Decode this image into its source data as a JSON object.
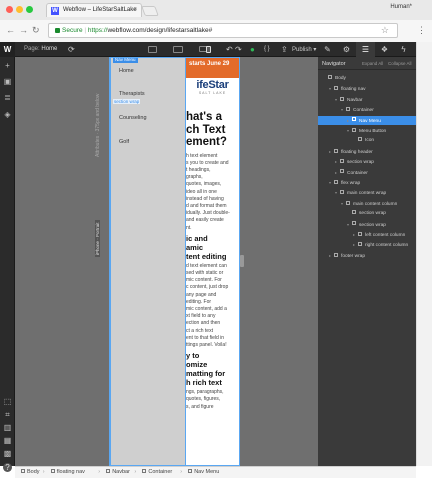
{
  "browser": {
    "tab_title": "Webflow – LifeStarSaltLake",
    "tab_favicon": "W",
    "tab_close": "×",
    "user": "Human*",
    "secure_label": "Secure",
    "url_sep": " | ",
    "url_scheme": "https://",
    "url": "webflow.com/design/lifestarsaltlake#",
    "back_icon": "←",
    "forward_icon": "→",
    "reload_icon": "↻",
    "star_icon": "☆",
    "menu_icon": "⋮",
    "dot_colors": [
      "#ff5f57",
      "#ffbd2e",
      "#28c940"
    ]
  },
  "designer": {
    "logo": "W",
    "page_label": "Page:",
    "page_name": "Home",
    "settings_icon": "⟳",
    "undo_icon": "↶",
    "redo_icon": "↷",
    "check_icon": "●",
    "code_icon": "{ }",
    "export_icon": "⇪",
    "publish_label": "Publish ▾",
    "right_tabs": [
      {
        "icon": "brush-icon",
        "glyph": "✎"
      },
      {
        "icon": "gear-icon",
        "glyph": "⚙"
      },
      {
        "icon": "navigator-icon",
        "glyph": "☰"
      },
      {
        "icon": "drops-icon",
        "glyph": "❖"
      },
      {
        "icon": "interactions-icon",
        "glyph": "ϟ"
      }
    ],
    "left_rail": [
      "+",
      "▣",
      "≣",
      "◈",
      "▤"
    ],
    "left_rail_bottom": [
      "⬚",
      "⌗",
      "▥",
      "▦",
      "▩",
      "?"
    ]
  },
  "canvas": {
    "nav_menu_tag": "Nav Menu",
    "nav_links": [
      "Home",
      "Therapists",
      "Counseling",
      "Golf"
    ],
    "section_wrap_tag": "section wrap",
    "hero_text": "starts June 29",
    "brand_big": "ifeStar",
    "brand_small": "SALT LAKE",
    "article_h1": "hat's a\nch Text\nement?",
    "article_p1": "h text element\ns you to create and\nt headings,\ngraphs,\nquotes, images,\nideo all in one\ninstead of having\nd and format them\nidually. Just double-\nand easily create\nnt.",
    "article_h2": "ic and\namic\ntent editing",
    "article_p2": "d text element can\nsed with static or\nmic content. For\nc content, just drop\nany page and\nediting. For\nmic content, add a\nxt field to any\nection and then\nct a rich text\nent to that field in\nttings panel. Voila!",
    "article_h3": "y to\nomize\nmatting for\nh rich text",
    "article_p3": "ngs, paragraphs,\nquotes, figures,\ns, and figure",
    "side_label_1": "Attributes · 375px and below",
    "side_label_2": "iPhone · Portrait"
  },
  "navigator": {
    "title": "Navigator",
    "expand_all": "Expand All",
    "collapse_all": "Collapse All",
    "rows": [
      {
        "label": "Body",
        "depth": 0,
        "caret": "",
        "selected": false
      },
      {
        "label": "floating nav",
        "depth": 1,
        "caret": "▾",
        "selected": false
      },
      {
        "label": "Navbar",
        "depth": 2,
        "caret": "▾",
        "selected": false
      },
      {
        "label": "Container",
        "depth": 3,
        "caret": "▾",
        "selected": false
      },
      {
        "label": "Nav Menu",
        "depth": 4,
        "caret": "▸",
        "selected": true
      },
      {
        "label": "Menu Button",
        "depth": 4,
        "caret": "▾",
        "selected": false
      },
      {
        "label": "Icon",
        "depth": 5,
        "caret": "",
        "selected": false
      },
      {
        "label": "floating header",
        "depth": 1,
        "caret": "▸",
        "selected": false
      },
      {
        "label": "section wrap",
        "depth": 2,
        "caret": "▸",
        "selected": false
      },
      {
        "label": "Container",
        "depth": 2,
        "caret": "▸",
        "selected": false
      },
      {
        "label": "flex wrap",
        "depth": 1,
        "caret": "▾",
        "selected": false
      },
      {
        "label": "main content wrap",
        "depth": 2,
        "caret": "▾",
        "selected": false
      },
      {
        "label": "main content column",
        "depth": 3,
        "caret": "▾",
        "selected": false
      },
      {
        "label": "section wrap",
        "depth": 4,
        "caret": "",
        "selected": false
      },
      {
        "label": "section wrap",
        "depth": 4,
        "caret": "▾",
        "selected": false
      },
      {
        "label": "left content column",
        "depth": 5,
        "caret": "▸",
        "selected": false
      },
      {
        "label": "right content column",
        "depth": 5,
        "caret": "▸",
        "selected": false
      },
      {
        "label": "footer wrap",
        "depth": 1,
        "caret": "▸",
        "selected": false
      }
    ]
  },
  "breadcrumb": [
    "Body",
    "floating nav",
    "Navbar",
    "Container",
    "Nav Menu"
  ],
  "colors": {
    "accent": "#3b8ee8",
    "hero": "#e36b2a",
    "brand": "#1a3e7a",
    "publish_ok": "#2fb857"
  }
}
